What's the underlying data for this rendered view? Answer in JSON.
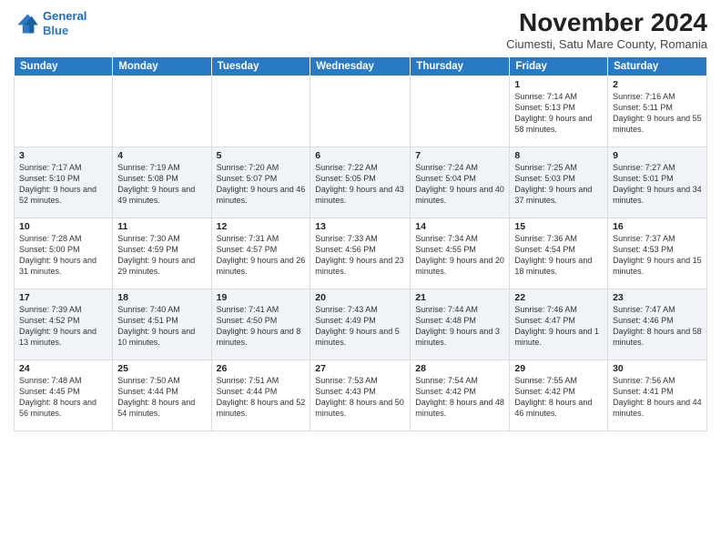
{
  "header": {
    "logo_line1": "General",
    "logo_line2": "Blue",
    "title": "November 2024",
    "subtitle": "Ciumesti, Satu Mare County, Romania"
  },
  "weekdays": [
    "Sunday",
    "Monday",
    "Tuesday",
    "Wednesday",
    "Thursday",
    "Friday",
    "Saturday"
  ],
  "weeks": [
    [
      {
        "day": "",
        "info": ""
      },
      {
        "day": "",
        "info": ""
      },
      {
        "day": "",
        "info": ""
      },
      {
        "day": "",
        "info": ""
      },
      {
        "day": "",
        "info": ""
      },
      {
        "day": "1",
        "info": "Sunrise: 7:14 AM\nSunset: 5:13 PM\nDaylight: 9 hours and 58 minutes."
      },
      {
        "day": "2",
        "info": "Sunrise: 7:16 AM\nSunset: 5:11 PM\nDaylight: 9 hours and 55 minutes."
      }
    ],
    [
      {
        "day": "3",
        "info": "Sunrise: 7:17 AM\nSunset: 5:10 PM\nDaylight: 9 hours and 52 minutes."
      },
      {
        "day": "4",
        "info": "Sunrise: 7:19 AM\nSunset: 5:08 PM\nDaylight: 9 hours and 49 minutes."
      },
      {
        "day": "5",
        "info": "Sunrise: 7:20 AM\nSunset: 5:07 PM\nDaylight: 9 hours and 46 minutes."
      },
      {
        "day": "6",
        "info": "Sunrise: 7:22 AM\nSunset: 5:05 PM\nDaylight: 9 hours and 43 minutes."
      },
      {
        "day": "7",
        "info": "Sunrise: 7:24 AM\nSunset: 5:04 PM\nDaylight: 9 hours and 40 minutes."
      },
      {
        "day": "8",
        "info": "Sunrise: 7:25 AM\nSunset: 5:03 PM\nDaylight: 9 hours and 37 minutes."
      },
      {
        "day": "9",
        "info": "Sunrise: 7:27 AM\nSunset: 5:01 PM\nDaylight: 9 hours and 34 minutes."
      }
    ],
    [
      {
        "day": "10",
        "info": "Sunrise: 7:28 AM\nSunset: 5:00 PM\nDaylight: 9 hours and 31 minutes."
      },
      {
        "day": "11",
        "info": "Sunrise: 7:30 AM\nSunset: 4:59 PM\nDaylight: 9 hours and 29 minutes."
      },
      {
        "day": "12",
        "info": "Sunrise: 7:31 AM\nSunset: 4:57 PM\nDaylight: 9 hours and 26 minutes."
      },
      {
        "day": "13",
        "info": "Sunrise: 7:33 AM\nSunset: 4:56 PM\nDaylight: 9 hours and 23 minutes."
      },
      {
        "day": "14",
        "info": "Sunrise: 7:34 AM\nSunset: 4:55 PM\nDaylight: 9 hours and 20 minutes."
      },
      {
        "day": "15",
        "info": "Sunrise: 7:36 AM\nSunset: 4:54 PM\nDaylight: 9 hours and 18 minutes."
      },
      {
        "day": "16",
        "info": "Sunrise: 7:37 AM\nSunset: 4:53 PM\nDaylight: 9 hours and 15 minutes."
      }
    ],
    [
      {
        "day": "17",
        "info": "Sunrise: 7:39 AM\nSunset: 4:52 PM\nDaylight: 9 hours and 13 minutes."
      },
      {
        "day": "18",
        "info": "Sunrise: 7:40 AM\nSunset: 4:51 PM\nDaylight: 9 hours and 10 minutes."
      },
      {
        "day": "19",
        "info": "Sunrise: 7:41 AM\nSunset: 4:50 PM\nDaylight: 9 hours and 8 minutes."
      },
      {
        "day": "20",
        "info": "Sunrise: 7:43 AM\nSunset: 4:49 PM\nDaylight: 9 hours and 5 minutes."
      },
      {
        "day": "21",
        "info": "Sunrise: 7:44 AM\nSunset: 4:48 PM\nDaylight: 9 hours and 3 minutes."
      },
      {
        "day": "22",
        "info": "Sunrise: 7:46 AM\nSunset: 4:47 PM\nDaylight: 9 hours and 1 minute."
      },
      {
        "day": "23",
        "info": "Sunrise: 7:47 AM\nSunset: 4:46 PM\nDaylight: 8 hours and 58 minutes."
      }
    ],
    [
      {
        "day": "24",
        "info": "Sunrise: 7:48 AM\nSunset: 4:45 PM\nDaylight: 8 hours and 56 minutes."
      },
      {
        "day": "25",
        "info": "Sunrise: 7:50 AM\nSunset: 4:44 PM\nDaylight: 8 hours and 54 minutes."
      },
      {
        "day": "26",
        "info": "Sunrise: 7:51 AM\nSunset: 4:44 PM\nDaylight: 8 hours and 52 minutes."
      },
      {
        "day": "27",
        "info": "Sunrise: 7:53 AM\nSunset: 4:43 PM\nDaylight: 8 hours and 50 minutes."
      },
      {
        "day": "28",
        "info": "Sunrise: 7:54 AM\nSunset: 4:42 PM\nDaylight: 8 hours and 48 minutes."
      },
      {
        "day": "29",
        "info": "Sunrise: 7:55 AM\nSunset: 4:42 PM\nDaylight: 8 hours and 46 minutes."
      },
      {
        "day": "30",
        "info": "Sunrise: 7:56 AM\nSunset: 4:41 PM\nDaylight: 8 hours and 44 minutes."
      }
    ]
  ]
}
